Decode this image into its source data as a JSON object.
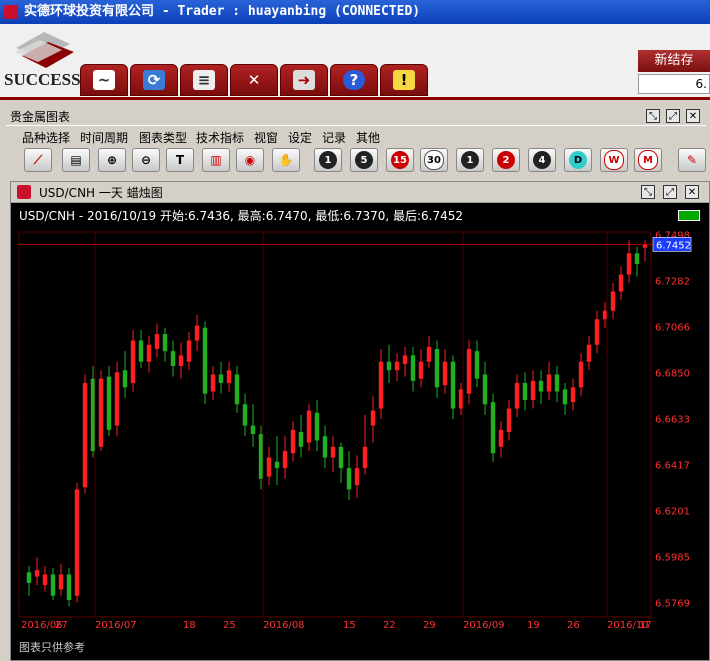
{
  "window": {
    "title": "实德环球投资有限公司 -  Trader : huayanbing (CONNECTED)"
  },
  "brand": {
    "logo_text": "SUCCESS"
  },
  "settlement": {
    "label": "新结存",
    "value": "6."
  },
  "panel": {
    "title": "贵金属图表"
  },
  "menu": [
    "品种选择",
    "时间周期",
    "图表类型",
    "技术指标",
    "视窗",
    "设定",
    "记录",
    "其他"
  ],
  "toolbar": {
    "period_buttons": [
      "1",
      "5",
      "15",
      "30",
      "1",
      "2",
      "4",
      "D",
      "W",
      "M"
    ]
  },
  "chart_window": {
    "title": "USD/CNH 一天 蜡烛图",
    "ohlc_line": "USD/CNH - 2016/10/19 开始:6.7436, 最高:6.7470, 最低:6.7370, 最后:6.7452",
    "disclaimer": "图表只供参考"
  },
  "colors": {
    "up": "#ff2020",
    "down": "#20b020",
    "grid": "#5a0000",
    "axis_text": "#ff3030",
    "current_price_bg": "#1a3cff"
  },
  "chart_data": {
    "type": "candlestick",
    "symbol": "USD/CNH",
    "period": "1D",
    "ylim": [
      6.57,
      6.751
    ],
    "y_ticks": [
      "6.7498",
      "6.7282",
      "6.7066",
      "6.6850",
      "6.6633",
      "6.6417",
      "6.6201",
      "6.5985",
      "6.5769"
    ],
    "x_ticks": [
      "2016/06",
      "27",
      "2016/07",
      "18",
      "25",
      "2016/08",
      "15",
      "22",
      "29",
      "2016/09",
      "19",
      "26",
      "2016/10",
      "17"
    ],
    "current_price": "6.7452",
    "grid": true,
    "candles": [
      [
        6.591,
        6.586,
        6.594,
        6.58
      ],
      [
        6.589,
        6.592,
        6.598,
        6.585
      ],
      [
        6.585,
        6.59,
        6.594,
        6.582
      ],
      [
        6.59,
        6.58,
        6.593,
        6.578
      ],
      [
        6.583,
        6.59,
        6.595,
        6.58
      ],
      [
        6.59,
        6.578,
        6.593,
        6.575
      ],
      [
        6.58,
        6.63,
        6.633,
        6.577
      ],
      [
        6.631,
        6.68,
        6.684,
        6.628
      ],
      [
        6.682,
        6.648,
        6.688,
        6.645
      ],
      [
        6.65,
        6.682,
        6.686,
        6.648
      ],
      [
        6.683,
        6.658,
        6.688,
        6.655
      ],
      [
        6.66,
        6.685,
        6.69,
        6.655
      ],
      [
        6.686,
        6.678,
        6.695,
        6.673
      ],
      [
        6.68,
        6.7,
        6.705,
        6.676
      ],
      [
        6.7,
        6.69,
        6.705,
        6.687
      ],
      [
        6.69,
        6.698,
        6.702,
        6.685
      ],
      [
        6.696,
        6.703,
        6.708,
        6.692
      ],
      [
        6.703,
        6.695,
        6.706,
        6.69
      ],
      [
        6.695,
        6.688,
        6.7,
        6.683
      ],
      [
        6.688,
        6.693,
        6.699,
        6.682
      ],
      [
        6.69,
        6.7,
        6.704,
        6.686
      ],
      [
        6.7,
        6.707,
        6.712,
        6.695
      ],
      [
        6.706,
        6.675,
        6.709,
        6.67
      ],
      [
        6.676,
        6.684,
        6.688,
        6.672
      ],
      [
        6.684,
        6.68,
        6.69,
        6.675
      ],
      [
        6.68,
        6.686,
        6.69,
        6.676
      ],
      [
        6.684,
        6.67,
        6.688,
        6.666
      ],
      [
        6.67,
        6.66,
        6.675,
        6.655
      ],
      [
        6.66,
        6.656,
        6.67,
        6.65
      ],
      [
        6.656,
        6.635,
        6.66,
        6.63
      ],
      [
        6.636,
        6.645,
        6.65,
        6.632
      ],
      [
        6.643,
        6.64,
        6.655,
        6.632
      ],
      [
        6.64,
        6.648,
        6.655,
        6.635
      ],
      [
        6.647,
        6.658,
        6.662,
        6.643
      ],
      [
        6.657,
        6.65,
        6.665,
        6.645
      ],
      [
        6.652,
        6.667,
        6.67,
        6.648
      ],
      [
        6.666,
        6.653,
        6.672,
        6.648
      ],
      [
        6.655,
        6.645,
        6.66,
        6.64
      ],
      [
        6.645,
        6.65,
        6.655,
        6.638
      ],
      [
        6.65,
        6.64,
        6.652,
        6.633
      ],
      [
        6.64,
        6.63,
        6.648,
        6.625
      ],
      [
        6.632,
        6.64,
        6.646,
        6.626
      ],
      [
        6.64,
        6.65,
        6.665,
        6.637
      ],
      [
        6.66,
        6.667,
        6.674,
        6.652
      ],
      [
        6.668,
        6.69,
        6.696,
        6.663
      ],
      [
        6.69,
        6.686,
        6.698,
        6.68
      ],
      [
        6.686,
        6.69,
        6.694,
        6.681
      ],
      [
        6.689,
        6.693,
        6.697,
        6.683
      ],
      [
        6.693,
        6.681,
        6.697,
        6.676
      ],
      [
        6.682,
        6.69,
        6.696,
        6.678
      ],
      [
        6.69,
        6.697,
        6.702,
        6.687
      ],
      [
        6.696,
        6.678,
        6.7,
        6.673
      ],
      [
        6.679,
        6.69,
        6.696,
        6.675
      ],
      [
        6.69,
        6.668,
        6.693,
        6.663
      ],
      [
        6.668,
        6.677,
        6.68,
        6.665
      ],
      [
        6.675,
        6.696,
        6.7,
        6.67
      ],
      [
        6.695,
        6.682,
        6.7,
        6.678
      ],
      [
        6.684,
        6.67,
        6.69,
        6.665
      ],
      [
        6.671,
        6.647,
        6.675,
        6.643
      ],
      [
        6.65,
        6.658,
        6.662,
        6.645
      ],
      [
        6.657,
        6.668,
        6.672,
        6.653
      ],
      [
        6.668,
        6.68,
        6.684,
        6.664
      ],
      [
        6.68,
        6.672,
        6.685,
        6.667
      ],
      [
        6.672,
        6.681,
        6.686,
        6.668
      ],
      [
        6.681,
        6.676,
        6.686,
        6.67
      ],
      [
        6.676,
        6.684,
        6.69,
        6.672
      ],
      [
        6.684,
        6.676,
        6.688,
        6.671
      ],
      [
        6.677,
        6.67,
        6.68,
        6.665
      ],
      [
        6.671,
        6.678,
        6.682,
        6.667
      ],
      [
        6.678,
        6.69,
        6.694,
        6.674
      ],
      [
        6.69,
        6.698,
        6.702,
        6.686
      ],
      [
        6.698,
        6.71,
        6.714,
        6.694
      ],
      [
        6.71,
        6.714,
        6.718,
        6.706
      ],
      [
        6.714,
        6.723,
        6.727,
        6.71
      ],
      [
        6.723,
        6.731,
        6.735,
        6.719
      ],
      [
        6.731,
        6.741,
        6.747,
        6.727
      ],
      [
        6.741,
        6.736,
        6.744,
        6.73
      ],
      [
        6.7436,
        6.7452,
        6.747,
        6.737
      ]
    ]
  }
}
